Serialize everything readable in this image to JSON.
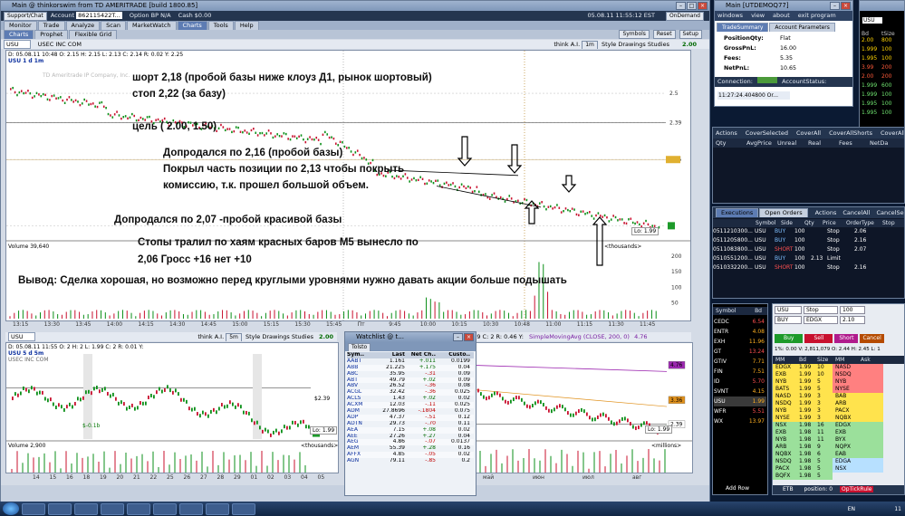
{
  "main": {
    "title": "Main @ thinkorswim from TD AMERITRADE [build 1800.85]",
    "account_bar": {
      "support": "Support/Chat",
      "account_label": "Account",
      "account_value": "862115422T...",
      "option_bp": "Option BP",
      "option_bp_value": "N/A",
      "cash": "Cash",
      "cash_value": "$0.00",
      "datetime": "05.08.11 11:55:12 EST",
      "ondemand": "OnDemand"
    },
    "tabs": [
      "Monitor",
      "Trade",
      "Analyze",
      "Scan",
      "MarketWatch",
      "Charts",
      "Tools",
      "Help"
    ],
    "subtabs": [
      "Charts",
      "Prophet",
      "Flexible Grid"
    ],
    "toolbar": {
      "symbols": "Symbols",
      "reset": "Reset",
      "setup": "Setup"
    },
    "chart1": {
      "symbol": "USU",
      "think": "think A.I.",
      "period": "1m",
      "style": "Style",
      "drawings": "Drawings",
      "studies": "Studies",
      "last": "2.00",
      "header": "USU 1 d 1m",
      "ohlc": "D: 05.08.11 10:48 O: 2.15 H: 2.15 L: 2.13 C: 2.14 R: 0.02 Y: 2.25",
      "company": "USEC INC COM",
      "watermark": "TD Ameritrade IP Company, Inc.",
      "price_labels": [
        "2.5",
        "2.39",
        "2.25",
        "2"
      ],
      "lo": "Lo: 1.99",
      "vol_header": "Volume 39,640",
      "vol_units": "<thousands>",
      "vol_ticks": [
        "200",
        "150",
        "100",
        "50"
      ],
      "x_labels": [
        "13:15",
        "13:30",
        "13:45",
        "14:00",
        "14:15",
        "14:30",
        "14:45",
        "15:00",
        "15:15",
        "15:30",
        "15:45",
        "Пт",
        "9:45",
        "10:00",
        "10:15",
        "10:30",
        "10:48",
        "11:00",
        "11:15",
        "11:30",
        "11:45"
      ]
    },
    "chart2": {
      "symbol": "USU",
      "think": "think A.I.",
      "period": "5m",
      "style": "Style",
      "drawings": "Drawings",
      "studies": "Studies",
      "last": "2.00",
      "header": "USU 5 d 5m",
      "ohlc": "D: 05.08.11 11:55 O: 2 H: 2 L: 1.99 C: 2 R: 0.01 Y:",
      "company": "USEC INC COM",
      "price_label": "$2.39",
      "lo": "Lo: 1.99",
      "dividend": "$-0.1b",
      "vol_header": "Volume 2,900",
      "vol_units": "<thousands>",
      "x_labels": [
        "14",
        "15",
        "16",
        "18",
        "19",
        "20",
        "21",
        "22",
        "25",
        "26",
        "27",
        "28",
        "29",
        "01",
        "02",
        "03",
        "04",
        "05"
      ]
    },
    "chart3": {
      "ohlc": "1.99 C: 2 R: 0.46 Y:",
      "study": "SimpleMovingAvg (CLOSE, 200, 0)",
      "study_value": "4.76",
      "price_labels": [
        "4.76",
        "3.36",
        "2.39"
      ],
      "lo": "Lo: 1.99",
      "vol_units": "<millions>",
      "x_labels": [
        "май",
        "июн",
        "июл",
        "авг"
      ]
    }
  },
  "annotations": [
    "шорт 2,18 (пробой базы ниже клоуз Д1, рынок шортовый)",
    "стоп 2,22 (за базу)",
    "цель ( 2.00, 1.50)",
    "Допродался по 2,16 (пробой базы)",
    "Покрыл часть позиции по 2,13 чтобы покрыть",
    "комиссию, т.к. прошел большой объем.",
    "Допродался по 2,07 -пробой красивой базы",
    "Стопы тралил по хаям красных баров М5  вынесло по",
    "2,06  Гросс +16  нет +10",
    "Вывод: Сделка хорошая, но возможно  перед круглыми уровнями нужно давать акции больше подышать"
  ],
  "watchlist": {
    "title": "Watchlist @ t...",
    "name": "Tolsto",
    "cols": [
      "Sym..",
      "Last",
      "Net Ch..",
      "Custo.."
    ],
    "rows": [
      [
        "AABT",
        "1.161",
        "+.011",
        "0.0199"
      ],
      [
        "ABB",
        "21.225",
        "+.175",
        "0.04"
      ],
      [
        "ABC",
        "35.95",
        "-.31",
        "0.09"
      ],
      [
        "ABT",
        "49.79",
        "+.02",
        "0.09"
      ],
      [
        "ABV",
        "26.52",
        "-.36",
        "0.08"
      ],
      [
        "ACGL",
        "32.42",
        "-.36",
        "0.025"
      ],
      [
        "ACLS",
        "1.43",
        "+.02",
        "0.02"
      ],
      [
        "ACXM",
        "12.03",
        "-.11",
        "0.025"
      ],
      [
        "ADM",
        "27.8696",
        "-.1804",
        "0.075"
      ],
      [
        "ADP",
        "47.37",
        "-.51",
        "0.12"
      ],
      [
        "ADTN",
        "29.73",
        "-.70",
        "0.11"
      ],
      [
        "AEA",
        "7.15",
        "+.08",
        "0.02"
      ],
      [
        "AEE",
        "27.26",
        "+.27",
        "0.04"
      ],
      [
        "AEG",
        "4.86",
        "-.07",
        "0.0137"
      ],
      [
        "AEM",
        "55.39",
        "+.28",
        "0.16"
      ],
      [
        "AFFX",
        "4.85",
        "-.05",
        "0.02"
      ],
      [
        "AGN",
        "79.11",
        "-.85",
        "0.2"
      ]
    ]
  },
  "tsmain": {
    "title": "Main [UTDEMOQ77]",
    "menu": [
      "windows",
      "view",
      "about",
      "exit program"
    ],
    "tabs": [
      "TradeSummary",
      "Account Parameters"
    ],
    "rows": [
      [
        "PositionQty:",
        "Flat"
      ],
      [
        "GrossPnL:",
        "16.00"
      ],
      [
        "Fees:",
        "5.35"
      ],
      [
        "NetPnL:",
        "10.65"
      ]
    ],
    "connection": "Connection:",
    "status": "AccountStatus:",
    "log": "11:27:24.404800 Or..."
  },
  "positions": {
    "actions": [
      "Actions",
      "CoverSelected",
      "CoverAll",
      "CoverAllShorts",
      "CoverAllL"
    ],
    "cols": [
      "Qty",
      "AvgPrice",
      "Unreal",
      "Real",
      "Fees",
      "NetDa"
    ]
  },
  "orders": {
    "tabs": [
      "Executions",
      "Open Orders"
    ],
    "actions": [
      "Actions",
      "CancelAll",
      "CancelSel"
    ],
    "cols": [
      "Symbol",
      "Side",
      "Qty",
      "Price",
      "OrderType",
      "Stop"
    ],
    "rows": [
      [
        "0511210300...",
        "USU",
        "BUY",
        "100",
        "",
        "Stop",
        "2.06"
      ],
      [
        "0511205800...",
        "USU",
        "BUY",
        "100",
        "",
        "Stop",
        "2.16"
      ],
      [
        "0511083800...",
        "USU",
        "SHORT",
        "100",
        "",
        "Stop",
        "2.07"
      ],
      [
        "0510551200...",
        "USU",
        "BUY",
        "100",
        "2.13",
        "Limit",
        ""
      ],
      [
        "0510332200...",
        "USU",
        "SHORT",
        "100",
        "",
        "Stop",
        "2.16"
      ]
    ]
  },
  "level2": {
    "symbol": "USU",
    "bid_title": "Bd",
    "stop": "Stop",
    "buy": "BUY",
    "edgx": "EDGX",
    "qty": "100",
    "price": "2.10",
    "btn_buy": "Buy",
    "btn_sell": "Sell",
    "btn_short": "Short",
    "btn_cancel": "Cancel",
    "stats": "1%: 0.00  V: 2,811,079  O: 2.44  H: 2.45  L: 1",
    "mm_cols": [
      "MM",
      "Bd",
      "Size",
      "MM",
      "Ask"
    ],
    "bids": [
      [
        "EDGX",
        "1.99",
        "10"
      ],
      [
        "EXB",
        "1.99",
        "10"
      ],
      [
        "NYB",
        "1.99",
        "5"
      ],
      [
        "BATS",
        "1.99",
        "5"
      ],
      [
        "NASD",
        "1.99",
        "3"
      ],
      [
        "NSDQ",
        "1.99",
        "3"
      ],
      [
        "NYB",
        "1.99",
        "3"
      ],
      [
        "NYSE",
        "1.99",
        "3"
      ],
      [
        "NSX",
        "1.98",
        "16"
      ],
      [
        "EXB",
        "1.98",
        "11"
      ],
      [
        "NYB",
        "1.98",
        "11"
      ],
      [
        "ARB",
        "1.98",
        "9"
      ],
      [
        "NQBX",
        "1.98",
        "6"
      ],
      [
        "NSDQ",
        "1.98",
        "5"
      ],
      [
        "PACX",
        "1.98",
        "5"
      ],
      [
        "BQFX",
        "1.98",
        "5"
      ]
    ],
    "asks": [
      "NASD",
      "NSDQ",
      "NYB",
      "NYSE",
      "BAB",
      "ARB",
      "PACX",
      "NQBX",
      "EDGX",
      "EXB",
      "BYX",
      "NQPX",
      "EAB",
      "EDGA",
      "NSX"
    ],
    "etb": "ETB",
    "position": "position:",
    "position_value": "0",
    "ticks": "OpTickRule"
  },
  "smallwin": {
    "symbol": "USU",
    "cols": [
      "Bd",
      "tSize"
    ],
    "rows": [
      [
        "2.00",
        "800"
      ],
      [
        "1.999",
        "100"
      ],
      [
        "1.995",
        "100"
      ],
      [
        "3.99",
        "200"
      ],
      [
        "2.00",
        "200"
      ],
      [
        "1.999",
        "600"
      ],
      [
        "1.999",
        "100"
      ],
      [
        "1.995",
        "100"
      ],
      [
        "1.995",
        "100"
      ]
    ]
  },
  "leftlist": {
    "cols": [
      "Symbol",
      "Bd"
    ],
    "rows": [
      [
        "CEDC",
        "6.54"
      ],
      [
        "ENTR",
        "4.08"
      ],
      [
        "EXH",
        "11.96"
      ],
      [
        "GT",
        "13.24"
      ],
      [
        "GTIV",
        "7.71"
      ],
      [
        "FIN",
        "7.51"
      ],
      [
        "ID",
        "5.70"
      ],
      [
        "SVNT",
        "4.15"
      ],
      [
        "USU",
        "1.99"
      ],
      [
        "WFR",
        "5.51"
      ],
      [
        "WX",
        "13.97"
      ]
    ],
    "addrow": "Add Row"
  },
  "taskbar": {
    "lang": "EN",
    "time": "11"
  },
  "colors": {
    "up": "#0b8f18",
    "down": "#c8102e",
    "accent": "#5d7cb3"
  }
}
